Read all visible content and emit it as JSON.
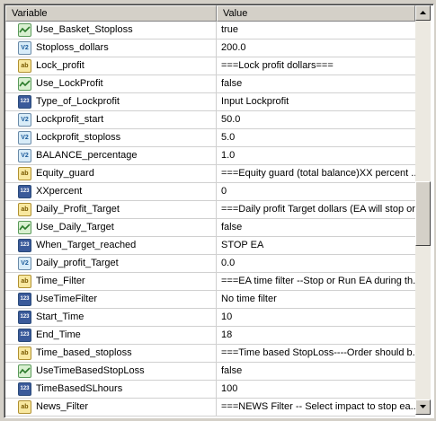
{
  "columns": {
    "variable": "Variable",
    "value": "Value"
  },
  "rows": [
    {
      "name": "Use_Basket_Stoploss",
      "value": "true",
      "type": "bool"
    },
    {
      "name": "Stoploss_dollars",
      "value": "200.0",
      "type": "double"
    },
    {
      "name": "Lock_profit",
      "value": "===Lock profit dollars===",
      "type": "string"
    },
    {
      "name": "Use_LockProfit",
      "value": "false",
      "type": "bool"
    },
    {
      "name": "Type_of_Lockprofit",
      "value": "Input Lockprofit",
      "type": "int"
    },
    {
      "name": "Lockprofit_start",
      "value": "50.0",
      "type": "double"
    },
    {
      "name": "Lockprofit_stoploss",
      "value": "5.0",
      "type": "double"
    },
    {
      "name": "BALANCE_percentage",
      "value": "1.0",
      "type": "double"
    },
    {
      "name": "Equity_guard",
      "value": "===Equity guard (total balance)XX percent ...",
      "type": "string"
    },
    {
      "name": "XXpercent",
      "value": "0",
      "type": "int"
    },
    {
      "name": "Daily_Profit_Target",
      "value": "===Daily profit Target dollars (EA will stop or...",
      "type": "string"
    },
    {
      "name": "Use_Daily_Target",
      "value": "false",
      "type": "bool"
    },
    {
      "name": "When_Target_reached",
      "value": "STOP EA",
      "type": "int"
    },
    {
      "name": "Daily_profit_Target",
      "value": "0.0",
      "type": "double"
    },
    {
      "name": "Time_Filter",
      "value": "===EA time filter --Stop or Run EA during th...",
      "type": "string"
    },
    {
      "name": "UseTimeFilter",
      "value": "No time filter",
      "type": "int"
    },
    {
      "name": "Start_Time",
      "value": "10",
      "type": "int"
    },
    {
      "name": "End_Time",
      "value": "18",
      "type": "int"
    },
    {
      "name": "Time_based_stoploss",
      "value": "===Time based StopLoss----Order should b...",
      "type": "string"
    },
    {
      "name": "UseTimeBasedStopLoss",
      "value": "false",
      "type": "bool"
    },
    {
      "name": "TimeBasedSLhours",
      "value": "100",
      "type": "int"
    },
    {
      "name": "News_Filter",
      "value": "===NEWS Filter -- Select impact to stop ea...",
      "type": "string"
    }
  ],
  "icons": {
    "bool": "bool-icon",
    "double": "double-icon",
    "string": "string-icon",
    "int": "int-icon"
  },
  "icon_glyphs": {
    "bool": "",
    "double": "V2",
    "string": "ab",
    "int": "123"
  },
  "scrollbar": {
    "up": "scroll-up",
    "down": "scroll-down"
  }
}
